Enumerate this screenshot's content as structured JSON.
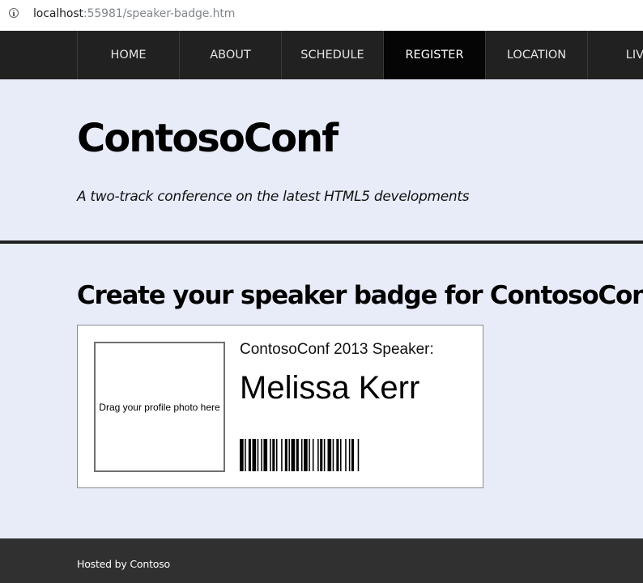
{
  "browser": {
    "url_host": "localhost",
    "url_rest": ":55981/speaker-badge.htm",
    "icon": "info-icon"
  },
  "nav": {
    "items": [
      {
        "label": "HOME"
      },
      {
        "label": "ABOUT"
      },
      {
        "label": "SCHEDULE"
      },
      {
        "label": "REGISTER",
        "active": true
      },
      {
        "label": "LOCATION"
      },
      {
        "label": "LIVE"
      }
    ]
  },
  "header": {
    "title": "ContosoConf",
    "tagline": "A two-track conference on the latest HTML5 developments"
  },
  "main": {
    "heading": "Create your speaker badge for ContosoConf",
    "badge": {
      "photo_placeholder": "Drag your profile photo here",
      "caption": "ContosoConf 2013 Speaker:",
      "name": "Melissa Kerr",
      "barcode_icon": "barcode-icon"
    }
  },
  "footer": {
    "text": "Hosted by Contoso"
  },
  "colors": {
    "nav_background": "#212121",
    "nav_active": "#050505",
    "page_background": "#e8ecf9",
    "footer_background": "#303030"
  }
}
